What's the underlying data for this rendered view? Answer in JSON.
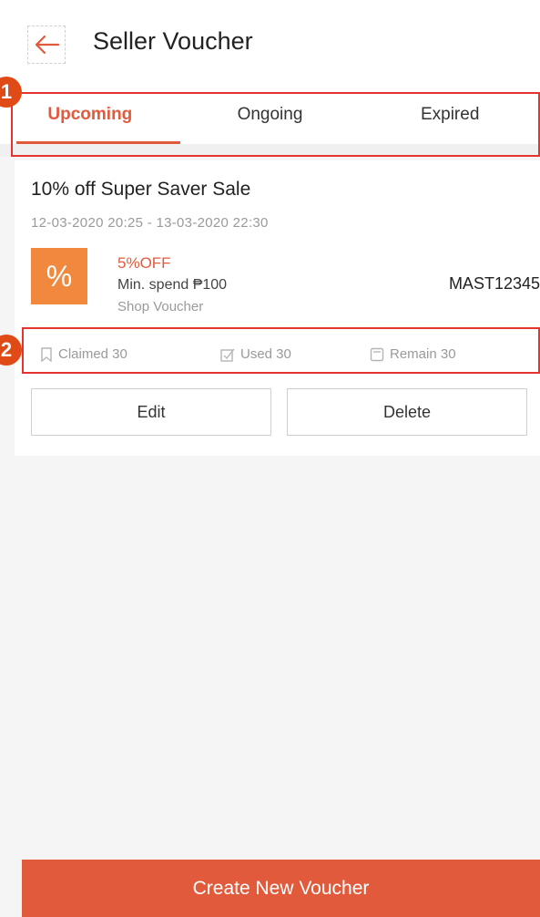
{
  "header": {
    "title": "Seller Voucher"
  },
  "tabs": [
    {
      "label": "Upcoming",
      "active": true
    },
    {
      "label": "Ongoing",
      "active": false
    },
    {
      "label": "Expired",
      "active": false
    }
  ],
  "markers": {
    "one": "1",
    "two": "2"
  },
  "voucher": {
    "name": "10% off Super Saver Sale",
    "dates": "12-03-2020 20:25 - 13-03-2020 22:30",
    "badge_symbol": "%",
    "discount": "5%OFF",
    "min_spend": "Min. spend ₱100",
    "type": "Shop Voucher",
    "code": "MAST12345",
    "stats": {
      "claimed": "Claimed 30",
      "used": "Used 30",
      "remain": "Remain 30"
    },
    "edit_label": "Edit",
    "delete_label": "Delete"
  },
  "footer": {
    "create_label": "Create New Voucher"
  },
  "colors": {
    "accent": "#e25a3c",
    "badge": "#f0883e",
    "annotation": "#e3342f"
  },
  "icons": {
    "back": "arrow-left-icon",
    "claimed": "bookmark-icon",
    "used": "checkbox-icon",
    "remain": "clipboard-icon"
  }
}
